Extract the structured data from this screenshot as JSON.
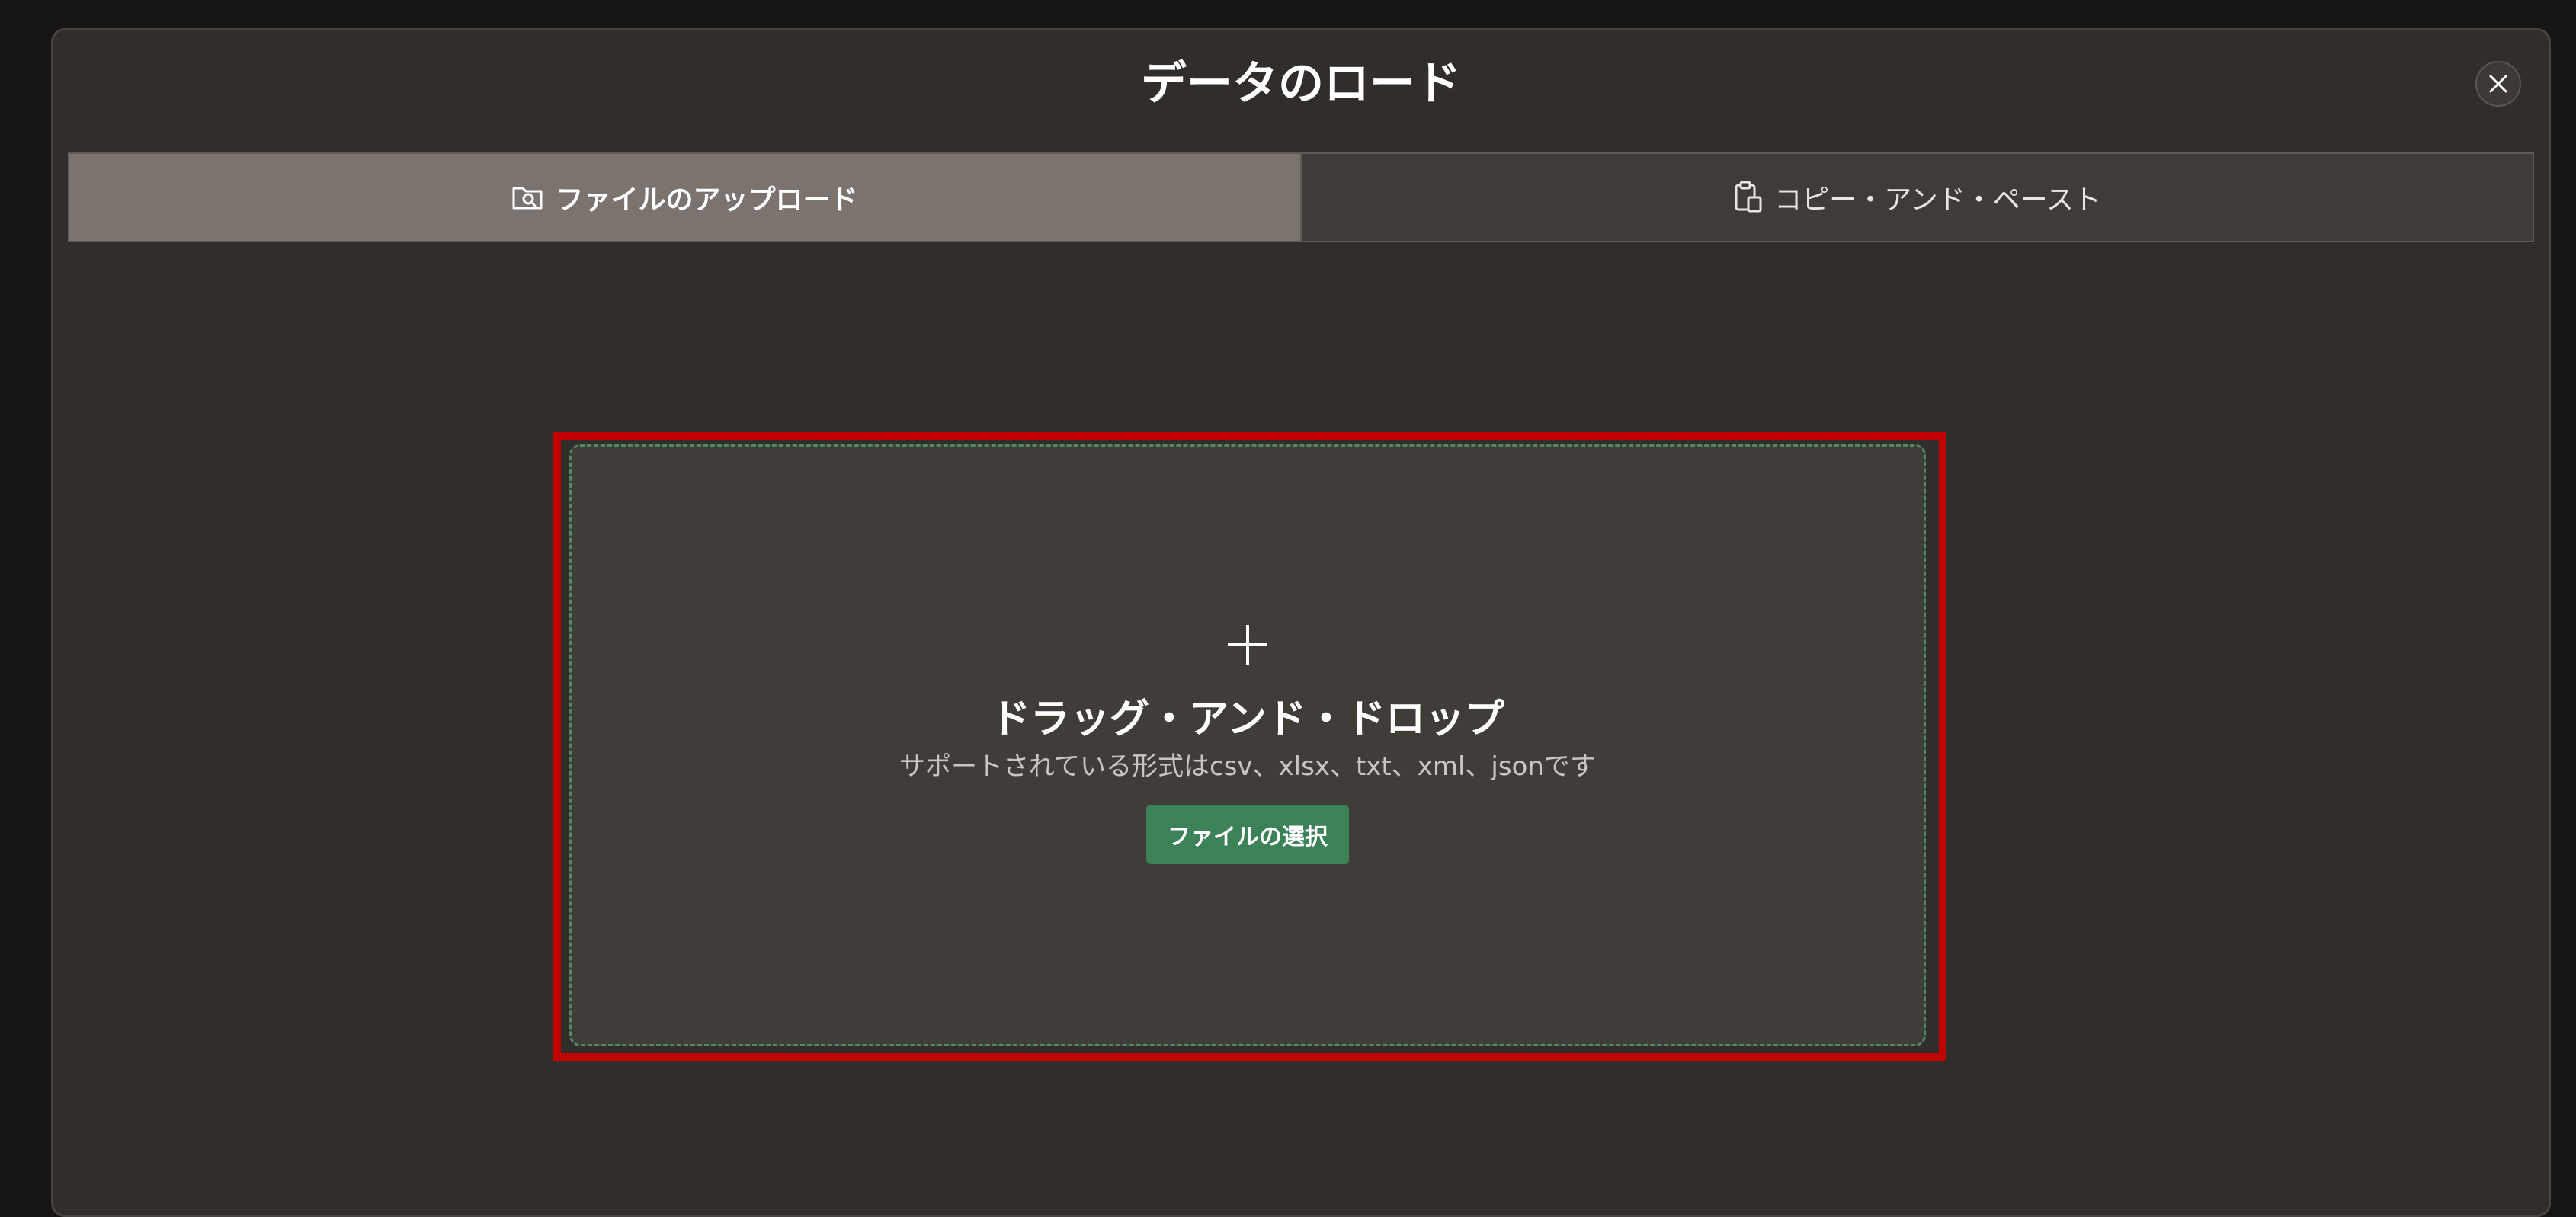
{
  "dialog": {
    "title": "データのロード",
    "close_icon": "close-icon"
  },
  "tabs": [
    {
      "label": "ファイルのアップロード",
      "icon": "folder-search-icon",
      "active": true
    },
    {
      "label": "コピー・アンド・ペースト",
      "icon": "clipboard-icon",
      "active": false
    }
  ],
  "dropzone": {
    "icon": "plus-icon",
    "title": "ドラッグ・アンド・ドロップ",
    "subtitle": "サポートされている形式はcsv、xlsx、txt、xml、jsonです",
    "button_label": "ファイルの選択"
  },
  "colors": {
    "background": "#161513",
    "dialog": "#312d2a",
    "active_tab": "#7b736e",
    "inactive_tab": "#3f3c38",
    "dropzone": "#403c37",
    "accent_green": "#3c8258",
    "highlight_red": "#c00000"
  }
}
